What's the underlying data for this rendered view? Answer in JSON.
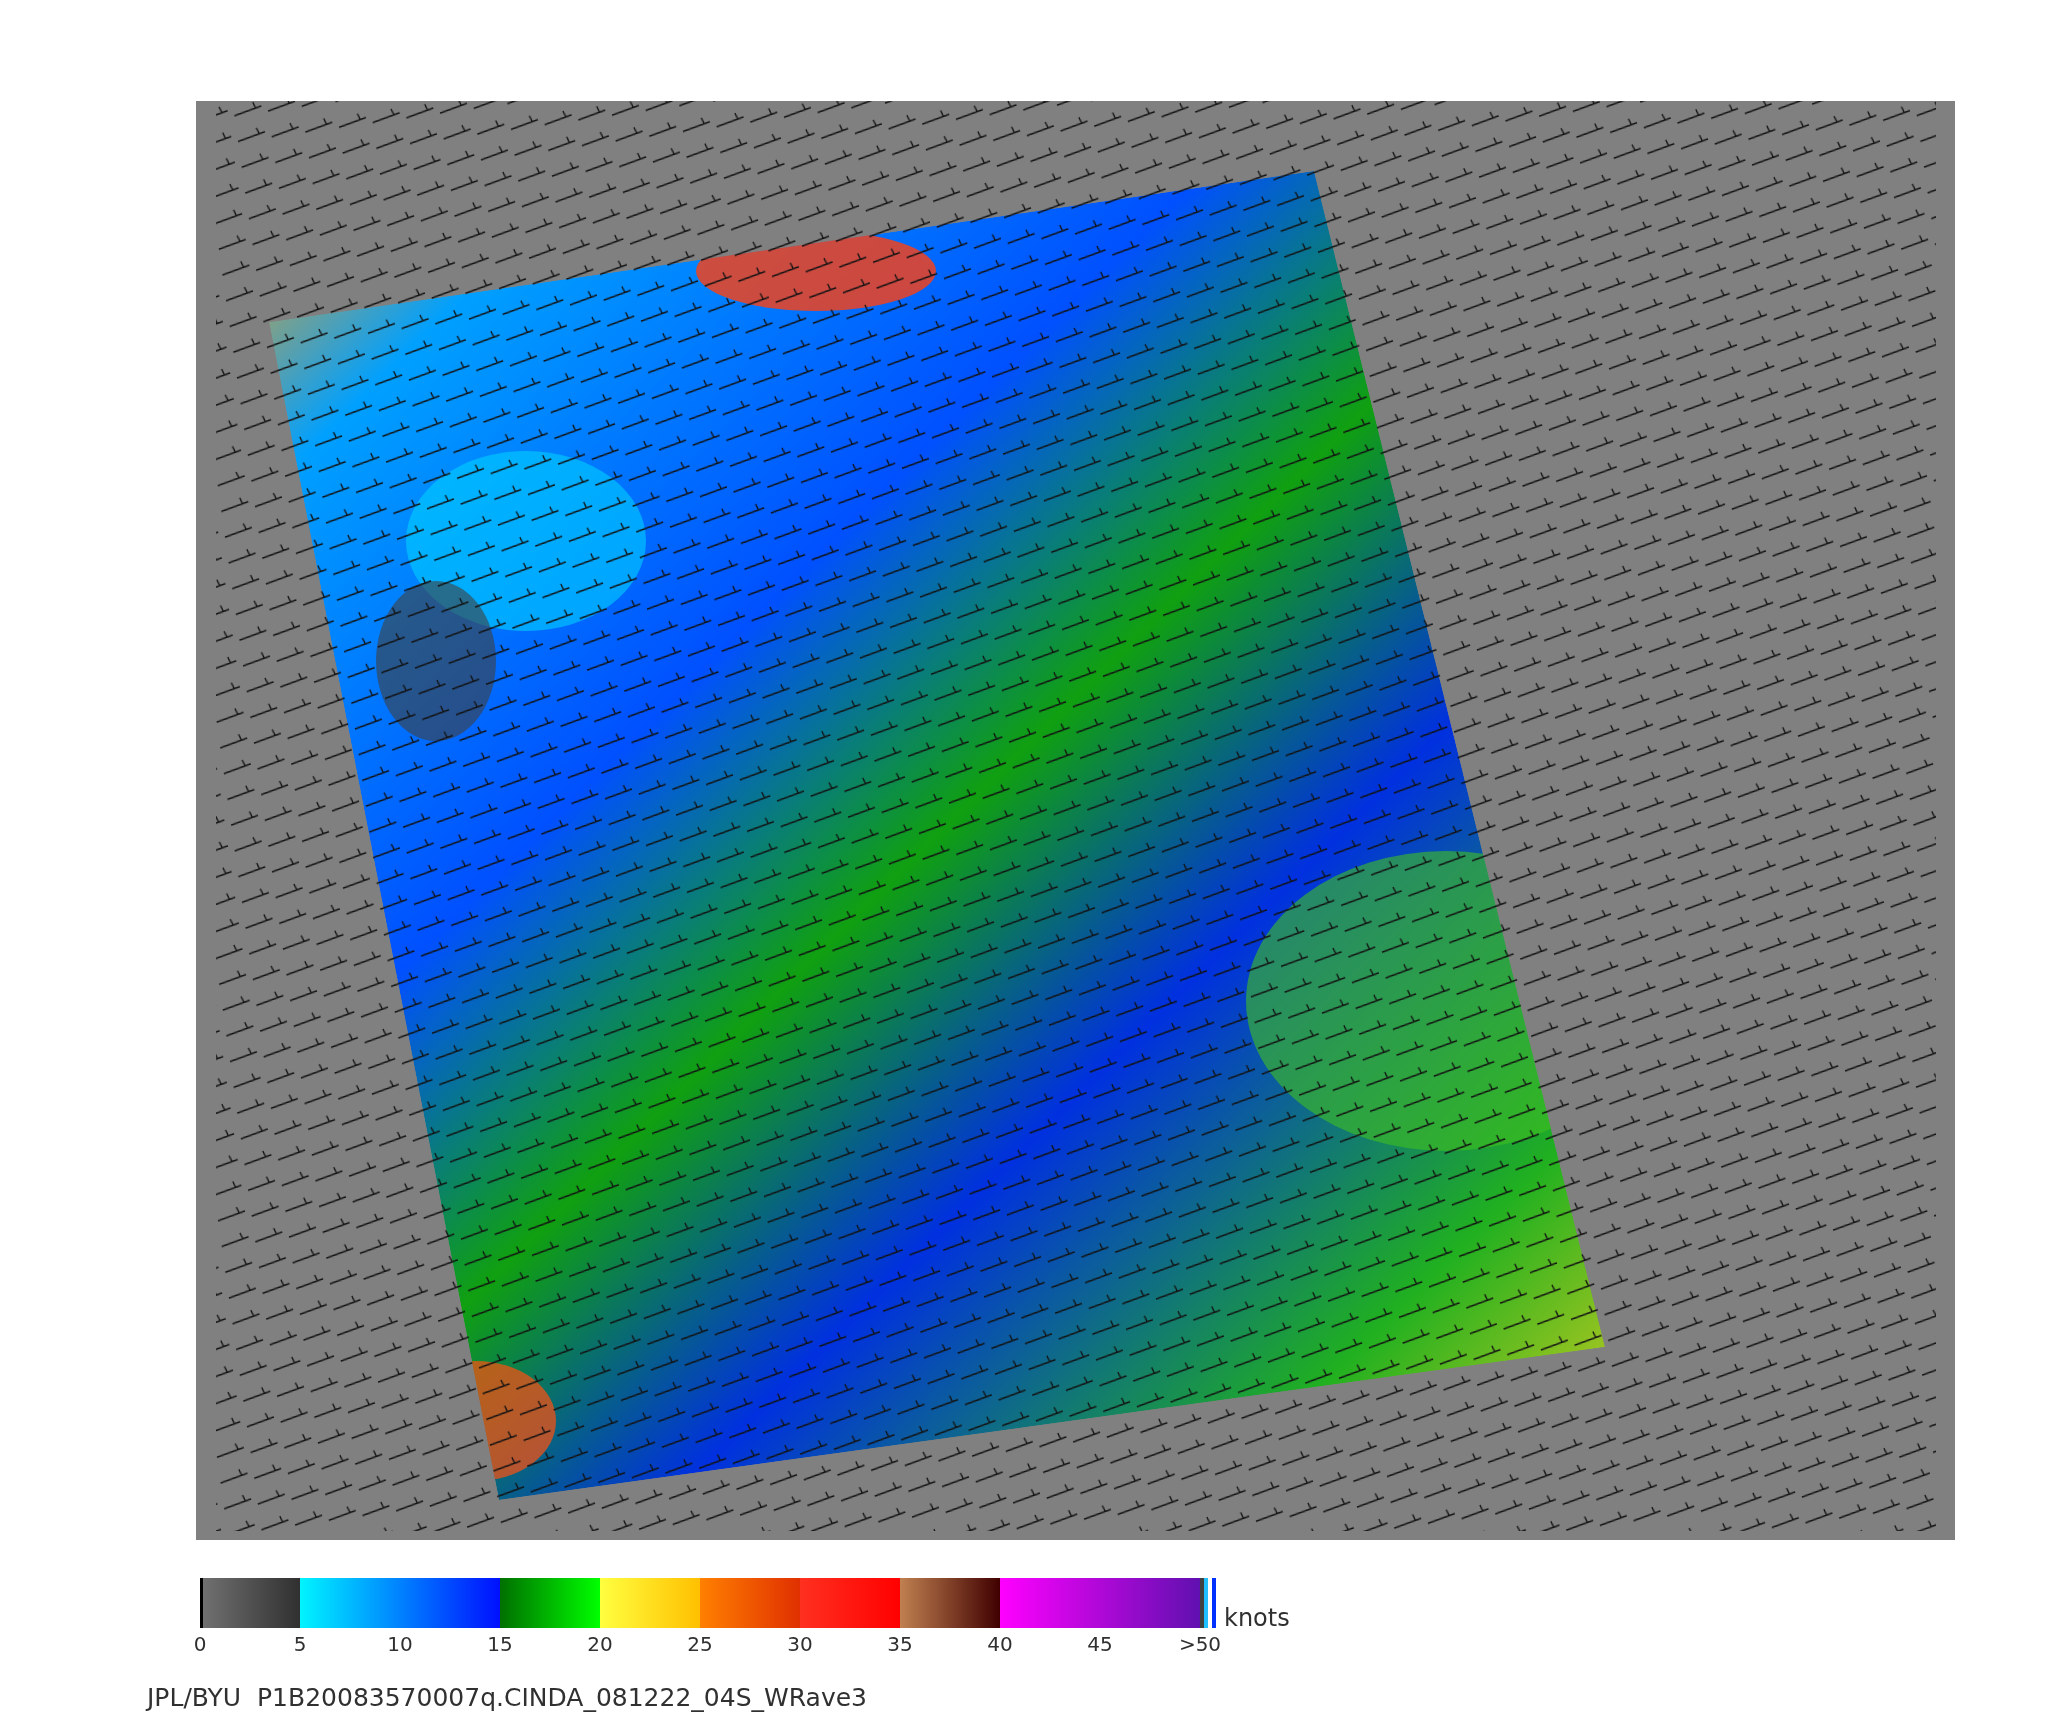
{
  "colorbar": {
    "ticks": [
      "0",
      "5",
      "10",
      "15",
      "20",
      "25",
      "30",
      "35",
      "40",
      "45",
      ">50"
    ],
    "unit": "knots"
  },
  "caption": "JPL/BYU  P1B20083570007q.CINDA_081222_04S_WRave3"
}
